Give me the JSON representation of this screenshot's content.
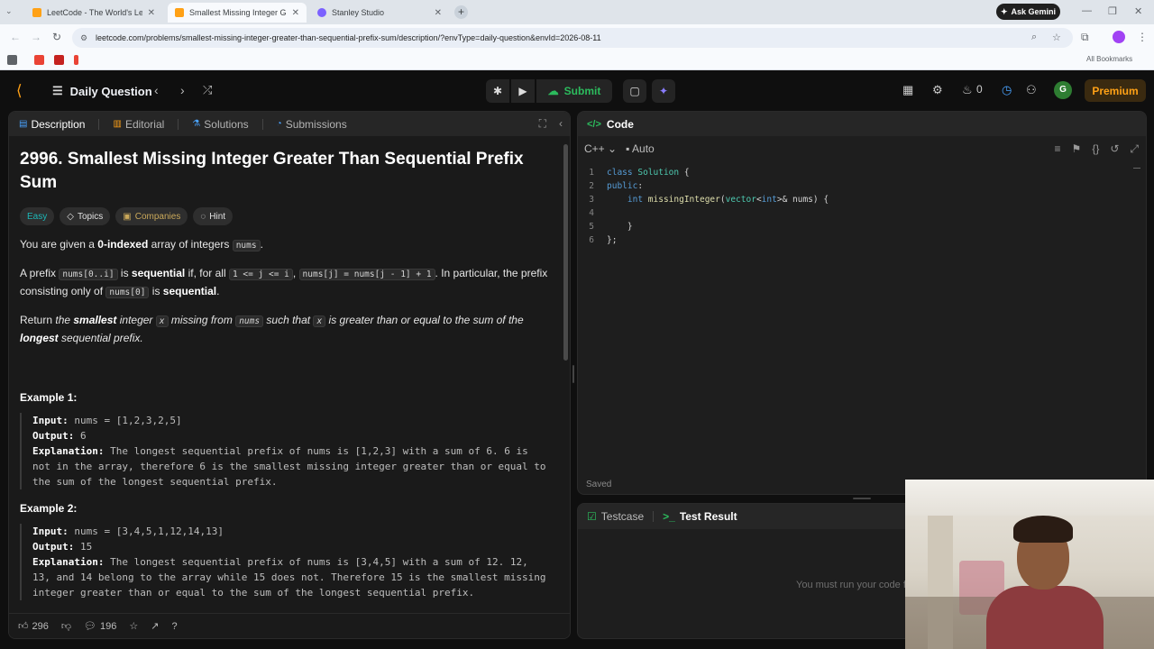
{
  "browser": {
    "tabs": [
      {
        "label": "LeetCode - The World's Leadin",
        "favicon_color": "#ffa116",
        "active": false
      },
      {
        "label": "Smallest Missing Integer Great",
        "favicon_color": "#ffa116",
        "active": true
      },
      {
        "label": "Stanley Studio",
        "favicon_color": "#7b61ff",
        "active": false
      }
    ],
    "ask_gemini": "Ask Gemini",
    "url": "leetcode.com/problems/smallest-missing-integer-greater-than-sequential-prefix-sum/description/?envType=daily-question&envId=2026-08-11",
    "all_bookmarks": "All Bookmarks"
  },
  "nav": {
    "daily_question": "Daily Question",
    "submit": "Submit",
    "streak": "0",
    "avatar_letter": "G",
    "premium": "Premium"
  },
  "left_tabs": {
    "description": "Description",
    "editorial": "Editorial",
    "solutions": "Solutions",
    "submissions": "Submissions"
  },
  "problem": {
    "title": "2996. Smallest Missing Integer Greater Than Sequential Prefix Sum",
    "difficulty": "Easy",
    "topics": "Topics",
    "companies": "Companies",
    "hint": "Hint",
    "p1_a": "You are given a ",
    "p1_b": "0-indexed",
    "p1_c": " array of integers ",
    "p1_code": "nums",
    "p1_d": ".",
    "p2_a": "A prefix ",
    "p2_code1": "nums[0..i]",
    "p2_b": " is ",
    "p2_bold1": "sequential",
    "p2_c": " if, for all ",
    "p2_code2": "1 <= j <= i",
    "p2_d": ", ",
    "p2_code3": "nums[j] = nums[j - 1] + 1",
    "p2_e": ". In particular, the prefix consisting only of ",
    "p2_code4": "nums[0]",
    "p2_f": " is ",
    "p2_bold2": "sequential",
    "p2_g": ".",
    "p3_a": "Return ",
    "p3_b": "the ",
    "p3_bold1": "smallest",
    "p3_c": " integer ",
    "p3_code1": "x",
    "p3_d": " missing from ",
    "p3_code2": "nums",
    "p3_e": " such that ",
    "p3_code3": "x",
    "p3_f": " is greater than or equal to the sum of the ",
    "p3_bold2": "longest",
    "p3_g": " sequential prefix.",
    "examples": [
      {
        "heading": "Example 1:",
        "input_label": "Input:",
        "input": " nums = [1,2,3,2,5]",
        "output_label": "Output:",
        "output": " 6",
        "expl_label": "Explanation:",
        "explanation": " The longest sequential prefix of nums is [1,2,3] with a sum of 6. 6 is not in the array, therefore 6 is the smallest missing integer greater than or equal to the sum of the longest sequential prefix."
      },
      {
        "heading": "Example 2:",
        "input_label": "Input:",
        "input": " nums = [3,4,5,1,12,14,13]",
        "output_label": "Output:",
        "output": " 15",
        "expl_label": "Explanation:",
        "explanation": " The longest sequential prefix of nums is [3,4,5] with a sum of 12. 12, 13, and 14 belong to the array while 15 does not. Therefore 15 is the smallest missing integer greater than or equal to the sum of the longest sequential prefix."
      }
    ]
  },
  "footer": {
    "likes": "296",
    "comments": "196"
  },
  "code": {
    "tab": "Code",
    "language": "C++",
    "mode": "Auto",
    "saved": "Saved",
    "line_numbers": [
      "1",
      "2",
      "3",
      "4",
      "5",
      "6"
    ]
  },
  "test": {
    "testcase": "Testcase",
    "test_result": "Test Result",
    "message": "You must run your code first"
  }
}
